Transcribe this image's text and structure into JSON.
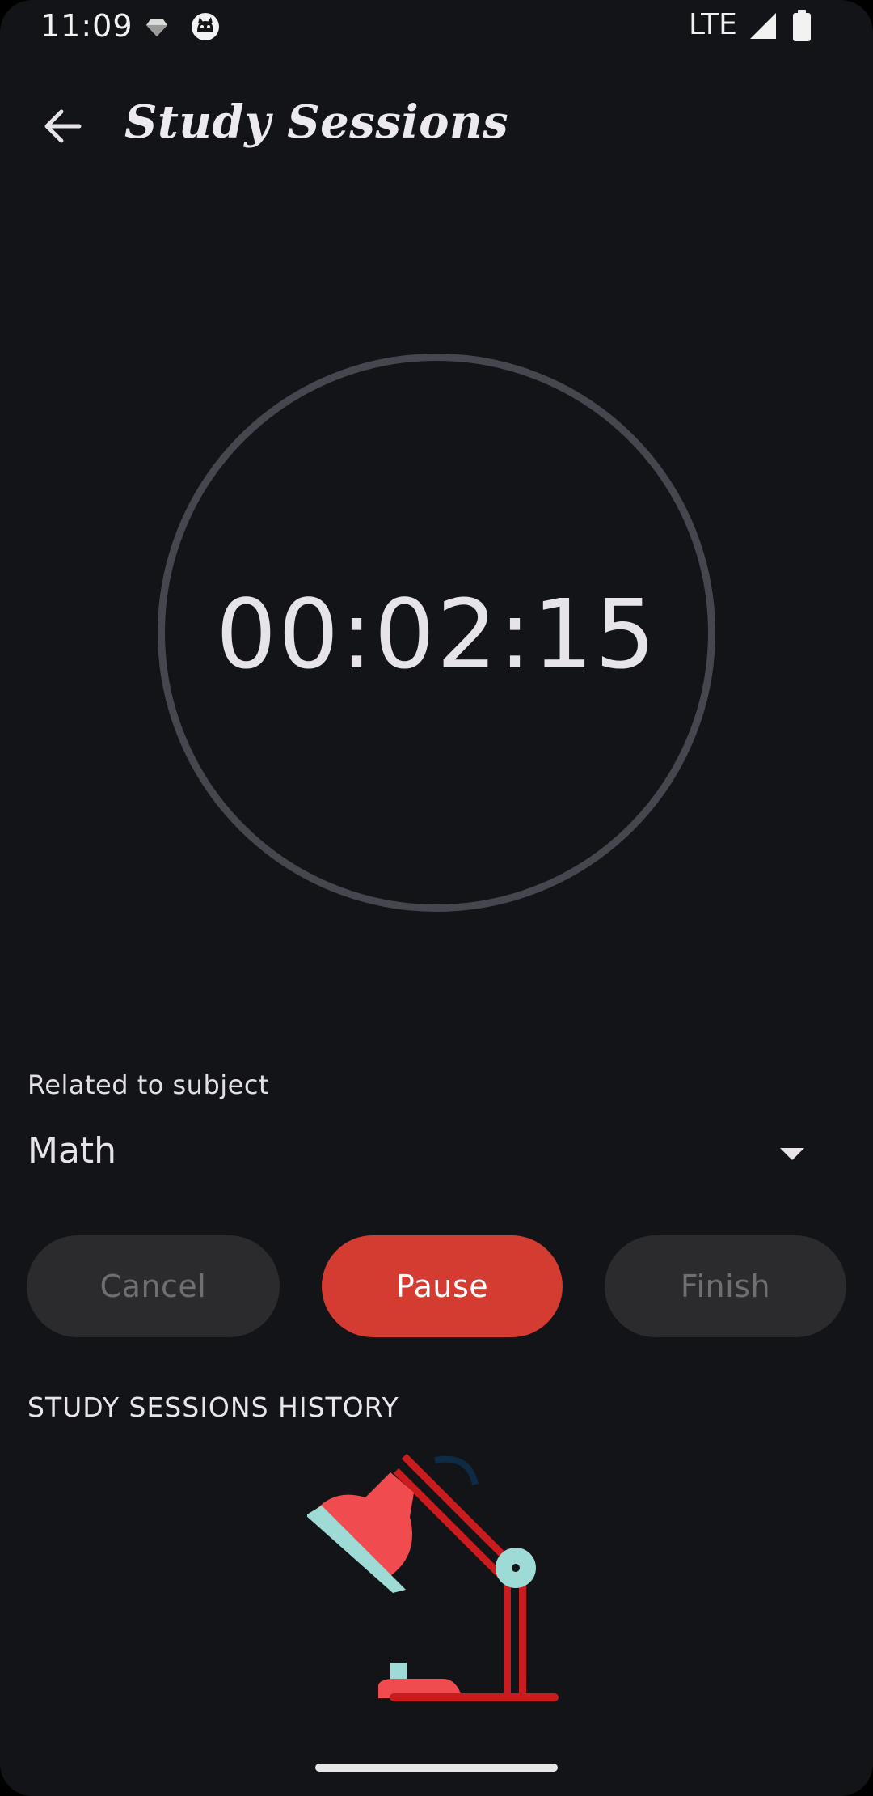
{
  "status_bar": {
    "time": "11:09",
    "network": "LTE",
    "icons": [
      "diamond-notification-icon",
      "cat-notification-icon",
      "signal-icon",
      "battery-icon"
    ]
  },
  "app_bar": {
    "title": "Study Sessions",
    "back_icon": "arrow-back-icon"
  },
  "timer": {
    "display": "00:02:15"
  },
  "subject": {
    "label": "Related to subject",
    "selected": "Math",
    "dropdown_icon": "arrow-drop-down-icon"
  },
  "actions": {
    "cancel_label": "Cancel",
    "pause_label": "Pause",
    "finish_label": "Finish"
  },
  "history": {
    "heading": "STUDY SESSIONS HISTORY",
    "illustration": "desk-lamp-illustration"
  },
  "colors": {
    "background": "#131418",
    "primary": "#d43b31",
    "ring": "#46464f",
    "disabled_button": "#2b2b2e",
    "lamp_red": "#f04b4f",
    "lamp_teal": "#9edbd6"
  }
}
